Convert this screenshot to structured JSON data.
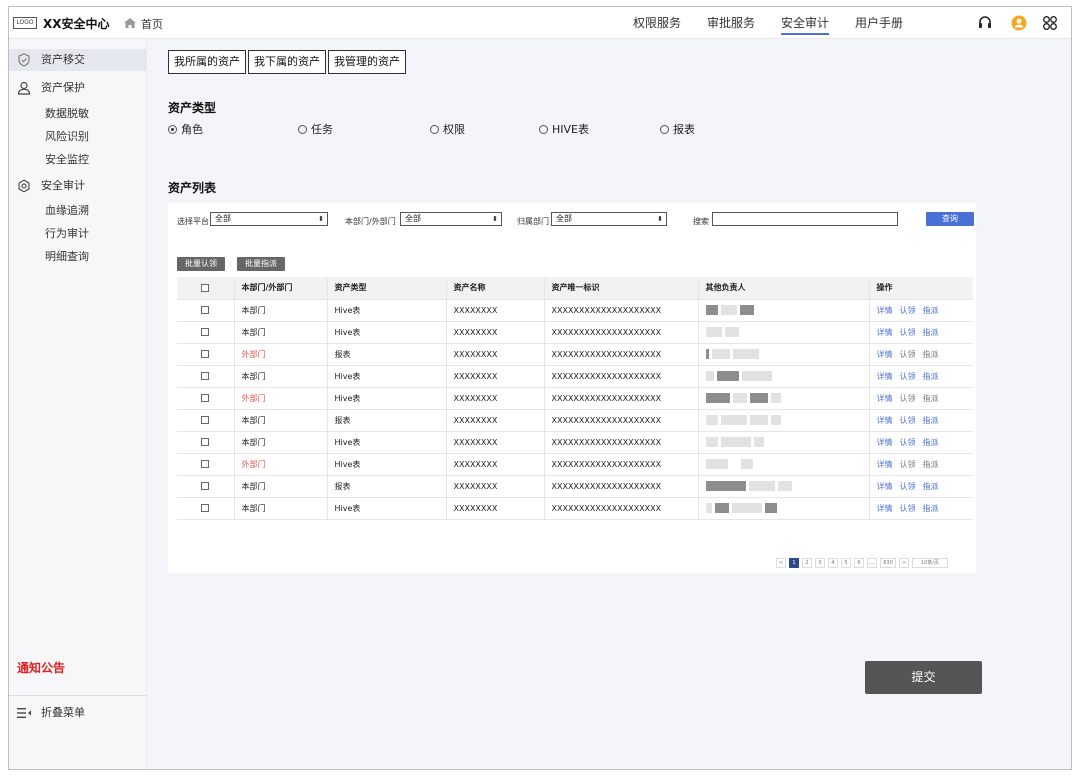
{
  "header": {
    "logo_text": "LOGO",
    "app_title": "XX安全中心",
    "home": "首页",
    "nav": [
      "权限服务",
      "审批服务",
      "安全审计",
      "用户手册"
    ],
    "active_nav": "安全审计",
    "accent_color": "#4a6fd6"
  },
  "sidebar": {
    "items": [
      {
        "label": "资产移交",
        "icon": "shield-icon",
        "active": true
      },
      {
        "label": "资产保护",
        "icon": "user-icon",
        "children": [
          "数据脱敏",
          "风险识别",
          "安全监控"
        ]
      },
      {
        "label": "安全审计",
        "icon": "gear-icon",
        "children": [
          "血缘追溯",
          "行为审计",
          "明细查询"
        ]
      }
    ],
    "notice": "通知公告",
    "collapse": "折叠菜单"
  },
  "main": {
    "tabs": [
      "我所属的资产",
      "我下属的资产",
      "我管理的资产"
    ],
    "asset_type_title": "资产类型",
    "asset_types": [
      "角色",
      "任务",
      "权限",
      "HIVE表",
      "报表"
    ],
    "asset_type_selected": "角色",
    "asset_list_title": "资产列表",
    "filters": {
      "platform_label": "选择平台",
      "platform_value": "全部",
      "dept_label": "本部门/外部门",
      "dept_value": "全部",
      "owner_dept_label": "归属部门",
      "owner_dept_value": "全部",
      "search_label": "搜索",
      "search_value": "",
      "query_button": "查询"
    },
    "batch_claim": "批量认领",
    "batch_assign": "批量指派",
    "table": {
      "headers": [
        "本部门/外部门",
        "资产类型",
        "资产名称",
        "资产唯一标识",
        "其他负责人",
        "操作"
      ],
      "rows": [
        {
          "dept": "本部门",
          "type": "Hive表",
          "name": "XXXXXXXX",
          "uid": "XXXXXXXXXXXXXXXXXXXX",
          "external": false
        },
        {
          "dept": "本部门",
          "type": "Hive表",
          "name": "XXXXXXXX",
          "uid": "XXXXXXXXXXXXXXXXXXXX",
          "external": false
        },
        {
          "dept": "外部门",
          "type": "报表",
          "name": "XXXXXXXX",
          "uid": "XXXXXXXXXXXXXXXXXXXX",
          "external": true
        },
        {
          "dept": "本部门",
          "type": "Hive表",
          "name": "XXXXXXXX",
          "uid": "XXXXXXXXXXXXXXXXXXXX",
          "external": false
        },
        {
          "dept": "外部门",
          "type": "Hive表",
          "name": "XXXXXXXX",
          "uid": "XXXXXXXXXXXXXXXXXXXX",
          "external": true
        },
        {
          "dept": "本部门",
          "type": "报表",
          "name": "XXXXXXXX",
          "uid": "XXXXXXXXXXXXXXXXXXXX",
          "external": false
        },
        {
          "dept": "本部门",
          "type": "Hive表",
          "name": "XXXXXXXX",
          "uid": "XXXXXXXXXXXXXXXXXXXX",
          "external": false
        },
        {
          "dept": "外部门",
          "type": "Hive表",
          "name": "XXXXXXXX",
          "uid": "XXXXXXXXXXXXXXXXXXXX",
          "external": true
        },
        {
          "dept": "本部门",
          "type": "报表",
          "name": "XXXXXXXX",
          "uid": "XXXXXXXXXXXXXXXXXXXX",
          "external": false
        },
        {
          "dept": "本部门",
          "type": "Hive表",
          "name": "XXXXXXXX",
          "uid": "XXXXXXXXXXXXXXXXXXXX",
          "external": false
        }
      ],
      "actions": [
        "详情",
        "认领",
        "指派"
      ]
    },
    "pagination": {
      "prev": "<",
      "pages": [
        "1",
        "2",
        "3",
        "4",
        "5",
        "6",
        "...",
        "630"
      ],
      "current": "1",
      "next": ">",
      "page_size": "10条/页"
    },
    "submit": "提交"
  }
}
